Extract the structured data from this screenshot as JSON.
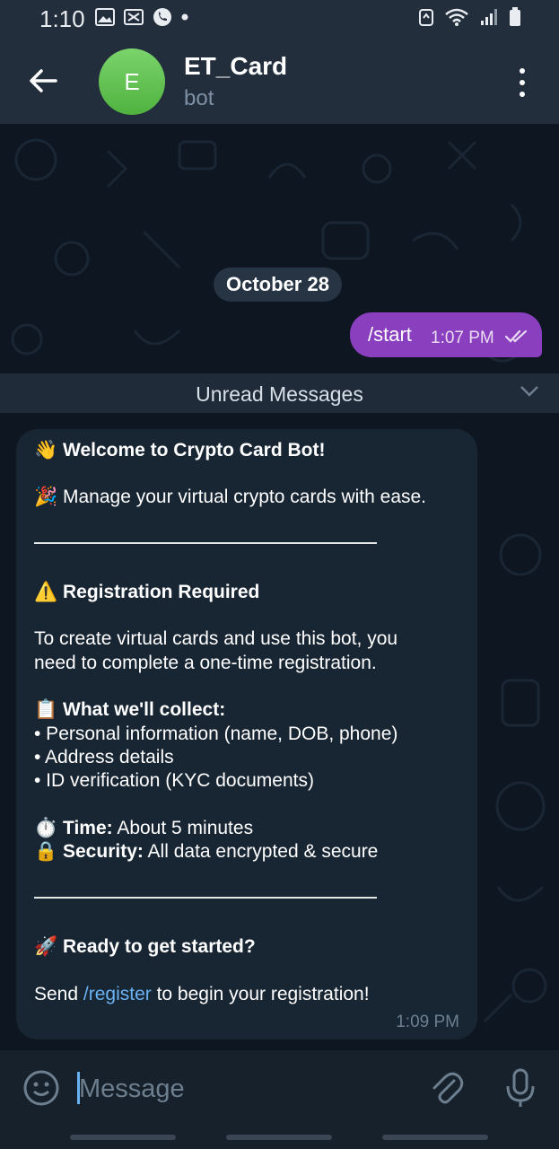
{
  "status_bar": {
    "time": "1:10"
  },
  "header": {
    "avatar_letter": "E",
    "title": "ET_Card",
    "subtitle": "bot"
  },
  "chat": {
    "date_label": "October 28",
    "outgoing": {
      "text": "/start",
      "time": "1:07 PM"
    },
    "unread_label": "Unread Messages",
    "incoming": {
      "welcome_emoji": "👋",
      "welcome": "Welcome to Crypto Card Bot!",
      "manage_emoji": "🎉",
      "manage": "Manage your virtual crypto cards with ease.",
      "reg_emoji": "⚠️",
      "reg_title": "Registration Required",
      "reg_body_1": "To create virtual cards and use this bot, you",
      "reg_body_2": "need to complete a one-time registration.",
      "collect_emoji": "📋",
      "collect_title": "What we'll collect:",
      "collect_1": "• Personal information (name, DOB, phone)",
      "collect_2": "• Address details",
      "collect_3": "• ID verification (KYC documents)",
      "time_emoji": "⏱️",
      "time_label": "Time:",
      "time_value": " About 5 minutes",
      "sec_emoji": "🔒",
      "sec_label": "Security:",
      "sec_value": " All data encrypted & secure",
      "ready_emoji": "🚀",
      "ready": "Ready to get started?",
      "send_prefix": "Send ",
      "send_link": "/register",
      "send_suffix": " to begin your registration!",
      "time": "1:09 PM"
    }
  },
  "input": {
    "placeholder": "Message"
  },
  "colors": {
    "header_bg": "#232e3c",
    "chat_bg": "#0e1621",
    "outgoing_bubble": "#8a3fbf",
    "incoming_bubble": "#182533",
    "link": "#6ab3f3",
    "avatar_green": "#5cbf4a"
  }
}
